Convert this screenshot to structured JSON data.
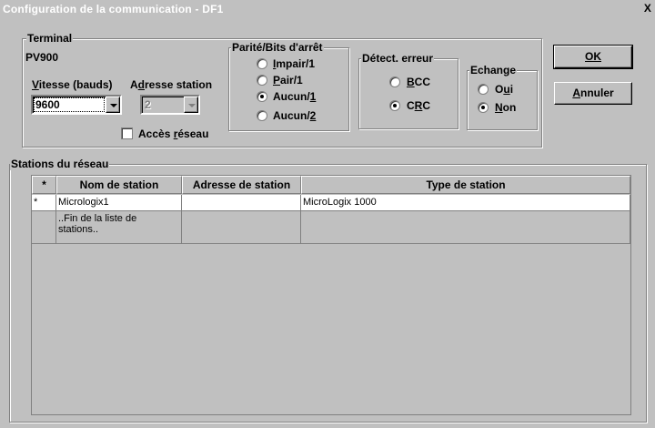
{
  "window": {
    "title": "Configuration de la communication - DF1",
    "close_label": "X"
  },
  "terminal": {
    "legend": "Terminal",
    "model": "PV900",
    "speed_label": "Vitesse (bauds)",
    "speed_value": "9600",
    "address_label": "Adresse station",
    "address_value": "2",
    "network_access_label": "Accès réseau"
  },
  "parity": {
    "legend": "Parité/Bits d'arrêt",
    "options": [
      "Impair/1",
      "Pair/1",
      "Aucun/1",
      "Aucun/2"
    ],
    "selected": "Aucun/1"
  },
  "error_detect": {
    "legend": "Détect. erreur",
    "options": [
      "BCC",
      "CRC"
    ],
    "selected": "CRC"
  },
  "exchange": {
    "legend": "Echange",
    "options": [
      "Oui",
      "Non"
    ],
    "selected": "Non"
  },
  "buttons": {
    "ok": "OK",
    "cancel": "Annuler"
  },
  "stations": {
    "legend": "Stations du réseau",
    "columns": [
      "*",
      "Nom de station",
      "Adresse de station",
      "Type de station"
    ],
    "rows": [
      {
        "marker": "*",
        "name": "Micrologix1",
        "address": "",
        "type": "MicroLogix 1000"
      },
      {
        "marker": "",
        "name": "..Fin de la liste de stations..",
        "address": "",
        "type": ""
      }
    ]
  }
}
